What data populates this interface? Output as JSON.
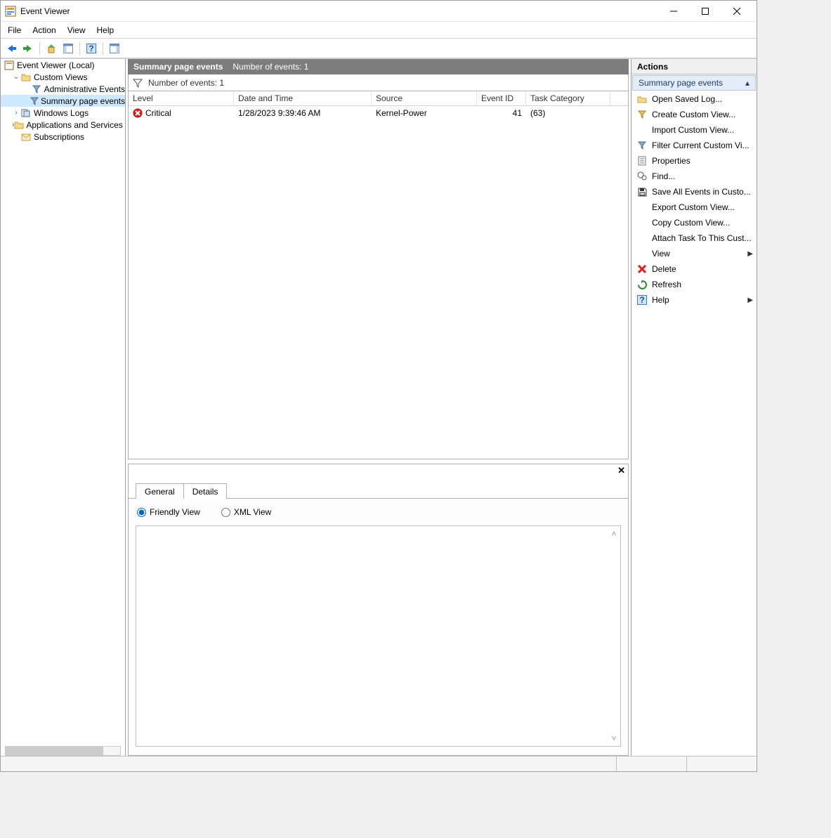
{
  "window": {
    "title": "Event Viewer"
  },
  "menubar": [
    "File",
    "Action",
    "View",
    "Help"
  ],
  "tree": {
    "root": "Event Viewer (Local)",
    "custom_views": "Custom Views",
    "admin_events": "Administrative Events",
    "summary_events": "Summary page events",
    "windows_logs": "Windows Logs",
    "apps_logs": "Applications and Services Lo",
    "subscriptions": "Subscriptions"
  },
  "center": {
    "header_title": "Summary page events",
    "header_count": "Number of events: 1",
    "filter_count": "Number of events: 1",
    "columns": {
      "level": "Level",
      "date": "Date and Time",
      "source": "Source",
      "eventid": "Event ID",
      "task": "Task Category"
    },
    "rows": [
      {
        "level": "Critical",
        "date": "1/28/2023 9:39:46 AM",
        "source": "Kernel-Power",
        "eventid": "41",
        "task": "(63)"
      }
    ]
  },
  "details": {
    "tab_general": "General",
    "tab_details": "Details",
    "radio_friendly": "Friendly View",
    "radio_xml": "XML View"
  },
  "actions": {
    "pane_title": "Actions",
    "section_title": "Summary page events",
    "items": [
      "Open Saved Log...",
      "Create Custom View...",
      "Import Custom View...",
      "Filter Current Custom Vi...",
      "Properties",
      "Find...",
      "Save All Events in Custo...",
      "Export Custom View...",
      "Copy Custom View...",
      "Attach Task To This Cust...",
      "View",
      "Delete",
      "Refresh",
      "Help"
    ]
  }
}
